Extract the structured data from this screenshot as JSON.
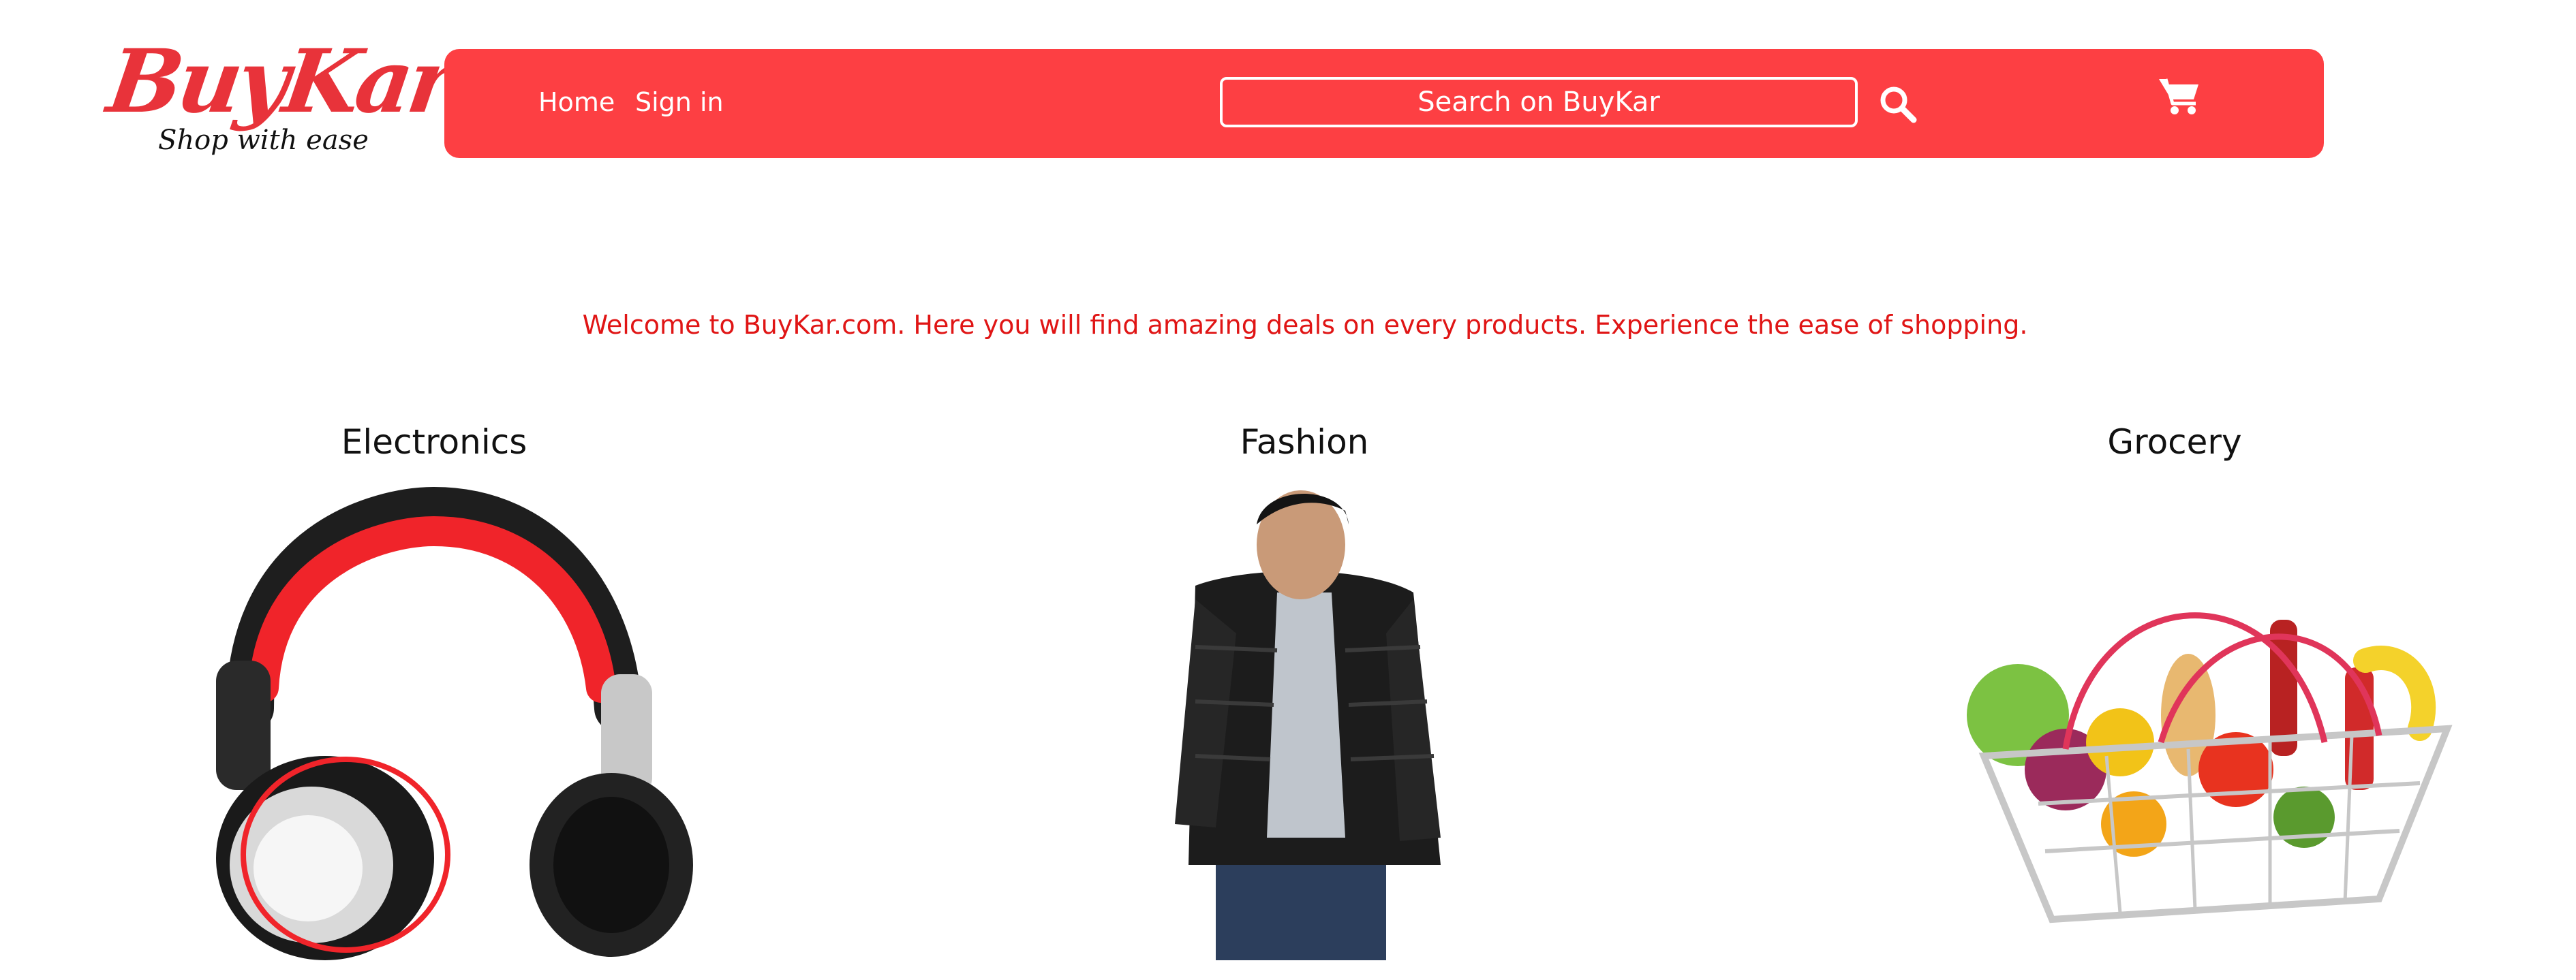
{
  "logo": {
    "name": "BuyKar",
    "tagline": "Shop with ease"
  },
  "nav": {
    "home": "Home",
    "sign_in": "Sign in"
  },
  "search": {
    "label": "Search on BuyKar"
  },
  "icons": {
    "search": "search-icon",
    "cart": "cart-icon"
  },
  "colors": {
    "brand_red": "#fd3f43",
    "welcome_text": "#e01515"
  },
  "welcome": "Welcome to BuyKar.com. Here you will find amazing deals on every products. Experience the ease of shopping.",
  "categories": [
    {
      "title": "Electronics"
    },
    {
      "title": "Fashion"
    },
    {
      "title": "Grocery"
    }
  ]
}
